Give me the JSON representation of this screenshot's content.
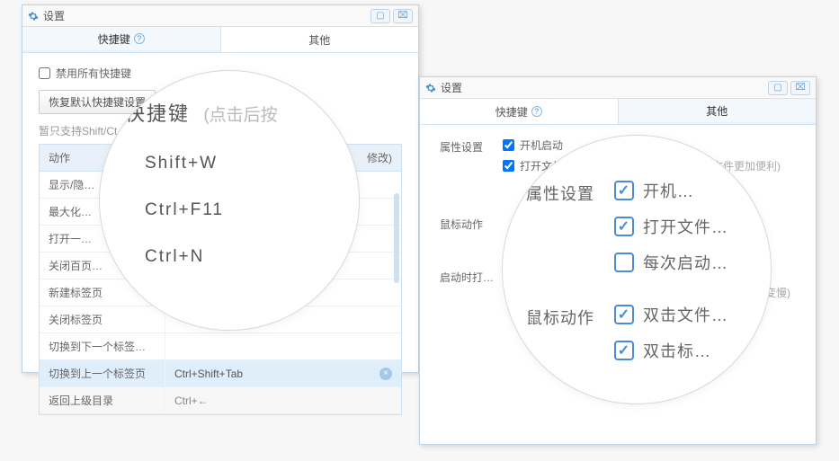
{
  "window_title": "设置",
  "tabs": {
    "shortcuts": "快捷键",
    "other": "其他"
  },
  "w1": {
    "disable_all": "禁用所有快捷键",
    "reset_button": "恢复默认快捷键设置",
    "note_prefix": "暂只支持Shift/Ct",
    "th_action": "动作",
    "th_key_suffix": "修改)",
    "rows": [
      {
        "action": "显示/隐…",
        "key": ""
      },
      {
        "action": "最大化…",
        "key": ""
      },
      {
        "action": "打开一…",
        "key": ""
      },
      {
        "action": "关闭百页…",
        "key": ""
      },
      {
        "action": "新建标签页",
        "key": ""
      },
      {
        "action": "关闭标签页",
        "key": ""
      },
      {
        "action": "切换到下一个标签…",
        "key": ""
      },
      {
        "action": "切换到上一个标签页",
        "key": "Ctrl+Shift+Tab"
      },
      {
        "action": "返回上级目录",
        "key": "Ctrl+←"
      }
    ]
  },
  "lens1": {
    "title": "快捷键",
    "subtitle": "(点击后按",
    "k1": "Shift+W",
    "k2": "Ctrl+F11",
    "k3": "Ctrl+N"
  },
  "w2": {
    "label_attr": "属性设置",
    "label_mouse": "鼠标动作",
    "label_startup": "启动时打…",
    "opt_autostart": "开机启动",
    "opt_openfile_prefix": "打开文件…",
    "opt_openfile_hint": "多标签管理文件系统，操作文件更加便利)",
    "hint_slow": "时加载速度变慢)"
  },
  "lens2": {
    "label_attr": "属性设置",
    "label_mouse": "鼠标动作",
    "opt_autostart": "开机…",
    "opt_openfile": "打开文件…",
    "opt_everystart": "每次启动…",
    "opt_dblfile": "双击文件…",
    "opt_dbltab": "双击标…"
  }
}
